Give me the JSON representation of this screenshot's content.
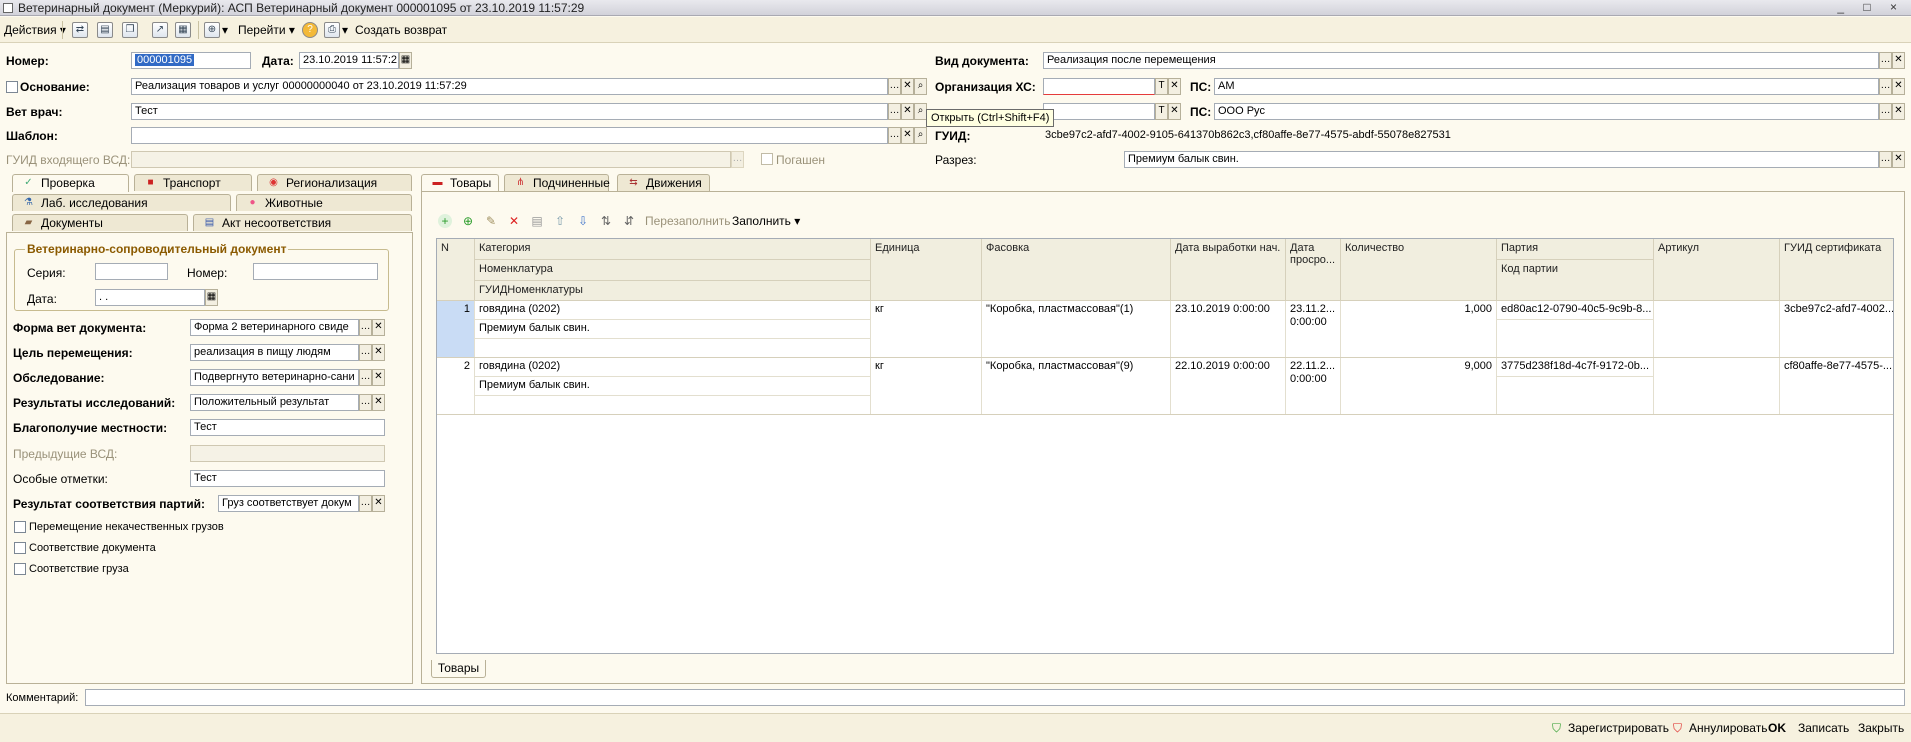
{
  "window": {
    "title": "Ветеринарный документ (Меркурий): АСП Ветеринарный документ 000001095 от 23.10.2019 11:57:29",
    "controls": "_ □ ×"
  },
  "toolbar": {
    "actions": "Действия",
    "goto": "Перейти",
    "create_return": "Создать возврат"
  },
  "header": {
    "number_label": "Номер:",
    "number_value": "000001095",
    "date_label": "Дата:",
    "date_value": "23.10.2019 11:57:2",
    "basis_label": "Основание:",
    "basis_value": "Реализация товаров и услуг 00000000040 от 23.10.2019 11:57:29",
    "vet_label": "Вет врач:",
    "vet_value": "Тест",
    "template_label": "Шаблон:",
    "template_value": "",
    "guid_in_label": "ГУИД входящего ВСД:",
    "guid_in_value": "",
    "repaid_label": "Погашен",
    "doc_type_label": "Вид документа:",
    "doc_type_value": "Реализация после перемещения",
    "org_label": "Организация ХС:",
    "org_value": "",
    "ps_label": "ПС:",
    "ps1_value": "АМ",
    "ps2_value": "ООО Рус",
    "guid_label": "ГУИД:",
    "guid_value": "3cbe97c2-afd7-4002-9105-641370b862c3,cf80affe-8e77-4575-abdf-55078e827531",
    "section_label": "Разрез:",
    "section_value": "Премиум балык свин.",
    "tooltip": "Открыть (Ctrl+Shift+F4)"
  },
  "left_tabs": [
    {
      "label": "Проверка",
      "icon": "check-icon"
    },
    {
      "label": "Транспорт",
      "icon": "truck-icon"
    },
    {
      "label": "Регионализация",
      "icon": "map-pin-icon"
    },
    {
      "label": "Лаб. исследования",
      "icon": "flask-icon"
    },
    {
      "label": "Животные",
      "icon": "pig-icon"
    },
    {
      "label": "Документы",
      "icon": "briefcase-icon"
    },
    {
      "label": "Акт несоответствия",
      "icon": "act-icon"
    }
  ],
  "vsd": {
    "group_title": "Ветеринарно-сопроводительный документ",
    "series_label": "Серия:",
    "series_value": "",
    "number_label": "Номер:",
    "number_value": "",
    "date_label": "Дата:",
    "date_value": " .  ."
  },
  "form": {
    "form_label": "Форма вет документа:",
    "form_value": "Форма 2 ветеринарного свиде",
    "purpose_label": "Цель перемещения:",
    "purpose_value": "реализация в пищу людям",
    "inspection_label": "Обследование:",
    "inspection_value": "Подвергнуто ветеринарно-сани",
    "results_label": "Результаты исследований:",
    "results_value": "Положительный результат",
    "wellbeing_label": "Благополучие местности:",
    "wellbeing_value": "Тест",
    "prev_label": "Предыдущие ВСД:",
    "prev_value": "",
    "marks_label": "Особые отметки:",
    "marks_value": "Тест",
    "match_label": "Результат соответствия партий:",
    "match_value": "Груз соответствует докум",
    "cb1": "Перемещение некачественных грузов",
    "cb2": "Соответствие документа",
    "cb3": "Соответствие груза"
  },
  "right_tabs": [
    {
      "label": "Товары",
      "icon": "goods-icon"
    },
    {
      "label": "Подчиненные",
      "icon": "hierarchy-icon"
    },
    {
      "label": "Движения",
      "icon": "movements-icon"
    }
  ],
  "grid_toolbar": {
    "refill": "Перезаполнить",
    "fill": "Заполнить"
  },
  "grid": {
    "headers": {
      "n": "N",
      "category": "Категория",
      "nomenclature": "Номенклатура",
      "guid_nom": "ГУИДНоменклатуры",
      "unit": "Единица",
      "packing": "Фасовка",
      "date_prod": "Дата выработки нач.",
      "date_exp": "Дата просро...",
      "qty": "Количество",
      "batch": "Партия",
      "batch_code": "Код партии",
      "article": "Артикул",
      "guid_cert": "ГУИД сертификата"
    },
    "rows": [
      {
        "n": "1",
        "category": "говядина (0202)",
        "nomenclature": "Премиум балык свин.",
        "unit": "кг",
        "packing": "\"Коробка, пластмассовая\"(1)",
        "date_prod": "23.10.2019 0:00:00",
        "date_exp1": "23.11.2...",
        "date_exp2": "0:00:00",
        "qty": "1,000",
        "batch": "ed80ac12-0790-40c5-9c9b-8...",
        "guid_cert": "3cbe97c2-afd7-4002..."
      },
      {
        "n": "2",
        "category": "говядина (0202)",
        "nomenclature": "Премиум балык свин.",
        "unit": "кг",
        "packing": "\"Коробка, пластмассовая\"(9)",
        "date_prod": "22.10.2019 0:00:00",
        "date_exp1": "22.11.2...",
        "date_exp2": "0:00:00",
        "qty": "9,000",
        "batch": "3775d238f18d-4c7f-9172-0b...",
        "guid_cert": "cf80affe-8e77-4575-..."
      }
    ],
    "bottom_tab": "Товары"
  },
  "comment_label": "Комментарий:",
  "footer": {
    "register": "Зарегистрировать",
    "cancel": "Аннулировать",
    "ok": "OK",
    "save": "Записать",
    "close": "Закрыть"
  }
}
